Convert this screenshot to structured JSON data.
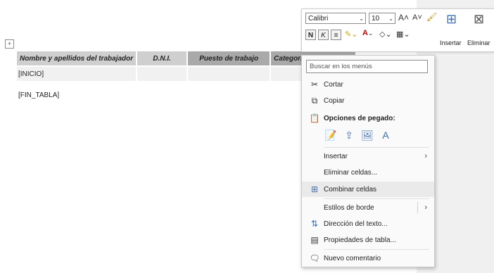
{
  "table": {
    "headers": [
      "Nombre y apellidos del trabajador",
      "D.N.I.",
      "Puesto de trabajo",
      "Categoría"
    ],
    "row": [
      "[INICIO]",
      "",
      "",
      ""
    ],
    "after": "[FIN_TABLA]"
  },
  "mini_toolbar": {
    "font": "Calibri",
    "size": "10",
    "bold": "N",
    "italic": "K",
    "insert_label": "Insertar",
    "delete_label": "Eliminar"
  },
  "menu": {
    "search_placeholder": "Buscar en los menús",
    "items": [
      {
        "label": "Cortar",
        "icon": "scissors-icon"
      },
      {
        "label": "Copiar",
        "icon": "copy-icon"
      },
      {
        "label": "Opciones de pegado:",
        "icon": "paste-icon"
      },
      {
        "label": "Insertar",
        "icon": "",
        "submenu": true
      },
      {
        "label": "Eliminar celdas...",
        "icon": ""
      },
      {
        "label": "Combinar celdas",
        "icon": "merge-cells-icon"
      },
      {
        "label": "Estilos de borde",
        "icon": "",
        "submenu": true
      },
      {
        "label": "Dirección del texto...",
        "icon": "text-direction-icon"
      },
      {
        "label": "Propiedades de tabla...",
        "icon": "table-properties-icon"
      },
      {
        "label": "Nuevo comentario",
        "icon": "comment-icon"
      }
    ]
  }
}
